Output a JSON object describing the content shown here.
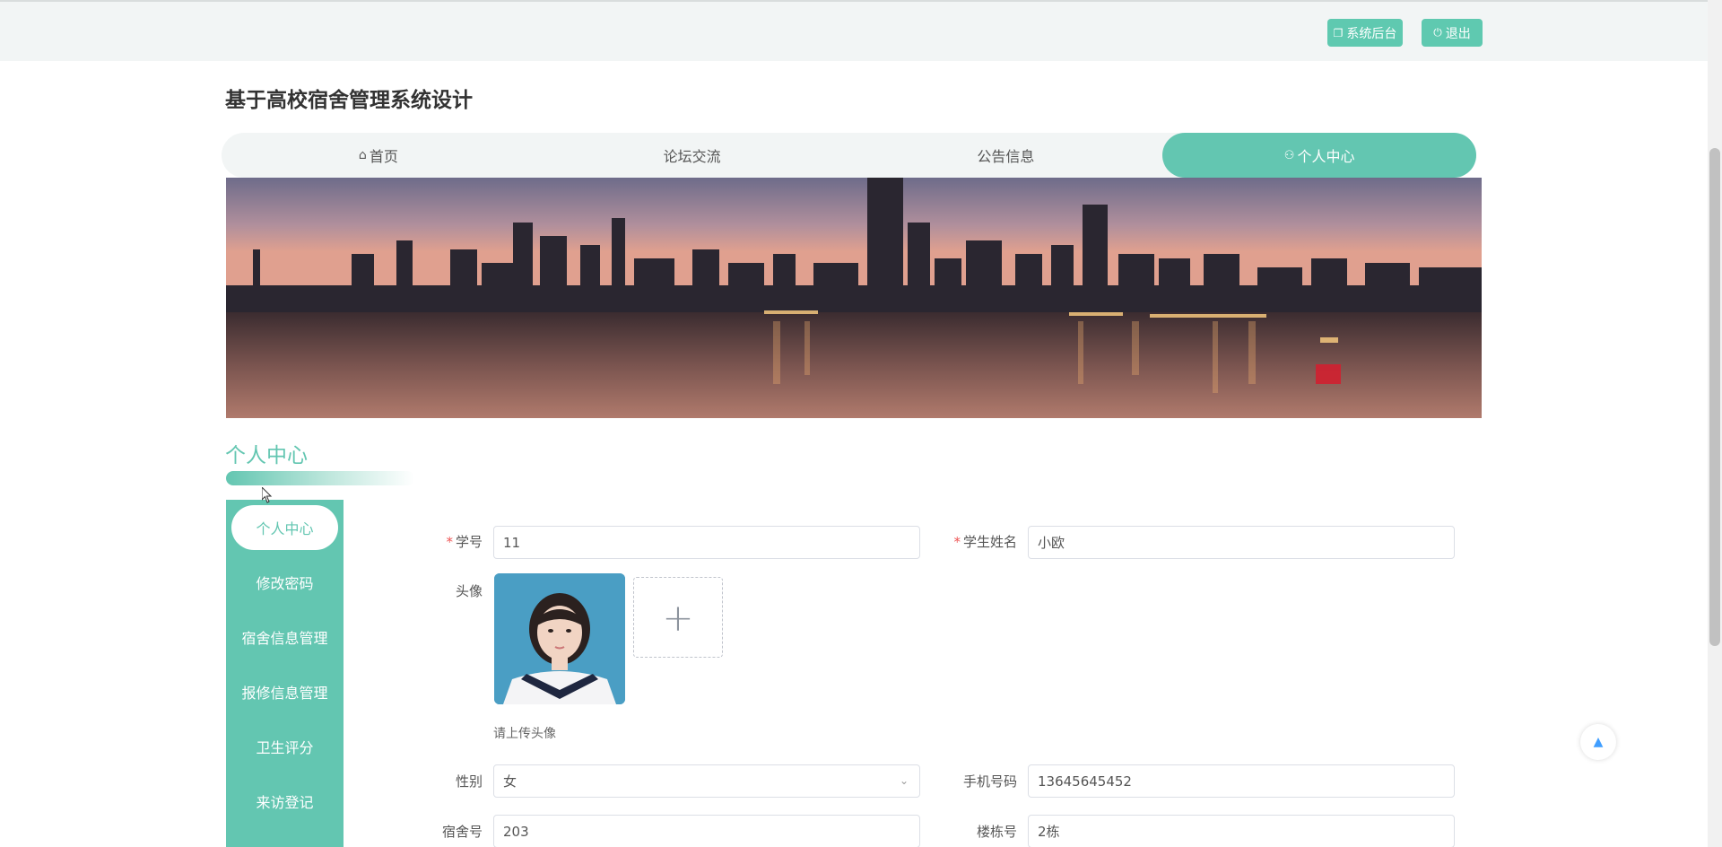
{
  "header": {
    "admin_label": "系统后台",
    "logout_label": "退出",
    "admin_icon": "copy-icon",
    "logout_icon": "power-icon"
  },
  "site": {
    "title": "基于高校宿舍管理系统设计"
  },
  "nav": {
    "items": [
      {
        "label": "首页",
        "icon": "home-icon"
      },
      {
        "label": "论坛交流"
      },
      {
        "label": "公告信息"
      },
      {
        "label": "个人中心",
        "icon": "user-icon",
        "active": true
      }
    ]
  },
  "section": {
    "title": "个人中心"
  },
  "side_menu": {
    "items": [
      {
        "label": "个人中心",
        "active": true
      },
      {
        "label": "修改密码"
      },
      {
        "label": "宿舍信息管理"
      },
      {
        "label": "报修信息管理"
      },
      {
        "label": "卫生评分"
      },
      {
        "label": "来访登记"
      }
    ]
  },
  "form": {
    "student_id": {
      "label": "学号",
      "value": "11",
      "required": true
    },
    "student_name": {
      "label": "学生姓名",
      "value": "小欧",
      "required": true
    },
    "avatar": {
      "label": "头像",
      "hint": "请上传头像",
      "upload_symbol": "+"
    },
    "gender": {
      "label": "性别",
      "value": "女"
    },
    "phone": {
      "label": "手机号码",
      "value": "13645645452"
    },
    "dorm_no": {
      "label": "宿舍号",
      "value": "203"
    },
    "building_no": {
      "label": "楼栋号",
      "value": "2栋"
    }
  },
  "colors": {
    "accent": "#63c6b1",
    "topbar_bg": "#f2f5f5",
    "required": "#ee5555"
  }
}
